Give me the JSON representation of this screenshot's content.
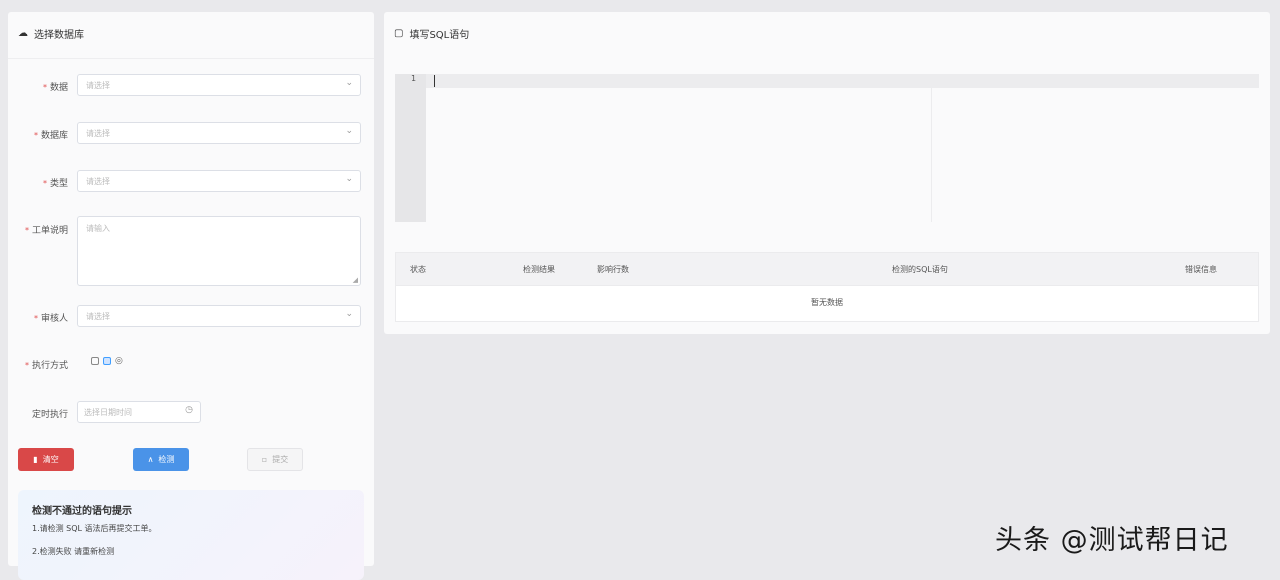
{
  "left_panel": {
    "title": "选择数据库",
    "fields": [
      {
        "label": "数据",
        "placeholder": "请选择"
      },
      {
        "label": "数据库",
        "placeholder": "请选择"
      },
      {
        "label": "类型",
        "placeholder": "请选择"
      }
    ],
    "textarea": {
      "label": "工单说明",
      "placeholder": "请输入"
    },
    "reviewer": {
      "label": "审核人",
      "placeholder": "请选择"
    },
    "execute_type": {
      "label": "执行方式"
    },
    "schedule": {
      "label": "定时执行",
      "placeholder": "选择日期时间"
    },
    "buttons": {
      "danger": "清空",
      "primary": "检测",
      "default": "提交"
    },
    "info": {
      "title": "检测不通过的语句提示",
      "line1": "1.请检测 SQL 语法后再提交工单。",
      "line2": "2.检测失败 请重新检测"
    }
  },
  "right_panel": {
    "title": "填写SQL语句",
    "editor": {
      "line_number": "1"
    },
    "table": {
      "headers": [
        "状态",
        "检测结果",
        "影响行数",
        "检测的SQL语句",
        "错误信息"
      ],
      "empty_text": "暂无数据"
    }
  },
  "watermark": "头条 @测试帮日记",
  "colors": {
    "danger": "#d94848",
    "primary": "#4a93e8",
    "background": "#e9e9ec"
  }
}
